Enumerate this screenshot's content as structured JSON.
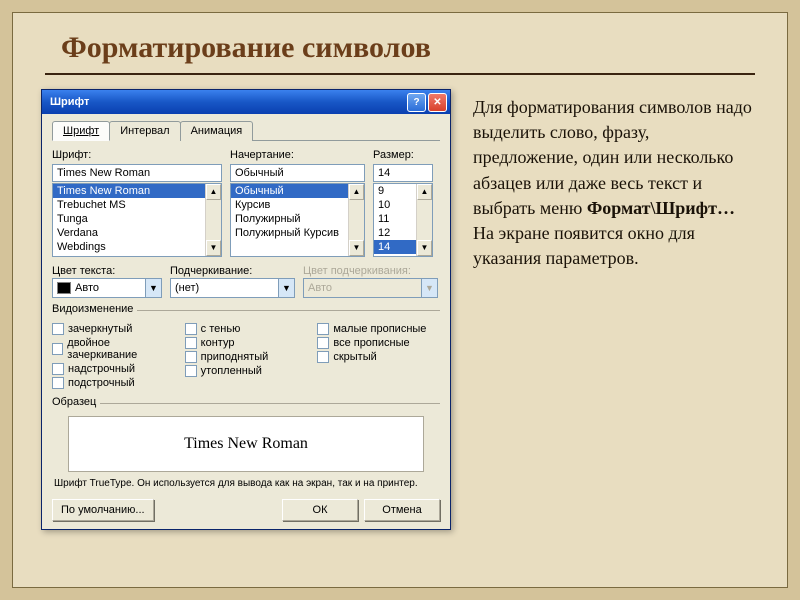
{
  "slide": {
    "title": "Форматирование символов",
    "para1": "Для форматирования символов надо выделить слово, фразу, предложение, один или несколько абзацев или даже весь текст и выбрать меню ",
    "menu_path": "Формат\\Шрифт…",
    "para2": " На экране появится окно для указания параметров."
  },
  "dialog": {
    "title": "Шрифт",
    "help_label": "?",
    "close_label": "✕",
    "tabs": [
      "Шрифт",
      "Интервал",
      "Анимация"
    ],
    "font_label": "Шрифт:",
    "font_value": "Times New Roman",
    "font_list": [
      "Times New Roman",
      "Trebuchet MS",
      "Tunga",
      "Verdana",
      "Webdings"
    ],
    "style_label": "Начертание:",
    "style_value": "Обычный",
    "style_list": [
      "Обычный",
      "Курсив",
      "Полужирный",
      "Полужирный Курсив"
    ],
    "size_label": "Размер:",
    "size_value": "14",
    "size_list": [
      "9",
      "10",
      "11",
      "12",
      "14"
    ],
    "color_label": "Цвет текста:",
    "color_value": "Авто",
    "underline_label": "Подчеркивание:",
    "underline_value": "(нет)",
    "ulcolor_label": "Цвет подчеркивания:",
    "ulcolor_value": "Авто",
    "effects_label": "Видоизменение",
    "checks_col1": [
      "зачеркнутый",
      "двойное зачеркивание",
      "надстрочный",
      "подстрочный"
    ],
    "checks_col2": [
      "с тенью",
      "контур",
      "приподнятый",
      "утопленный"
    ],
    "checks_col3": [
      "малые прописные",
      "все прописные",
      "скрытый"
    ],
    "sample_label": "Образец",
    "sample_text": "Times New Roman",
    "hint": "Шрифт TrueType. Он используется для вывода как на экран, так и на принтер.",
    "btn_default": "По умолчанию...",
    "btn_ok": "ОК",
    "btn_cancel": "Отмена"
  }
}
